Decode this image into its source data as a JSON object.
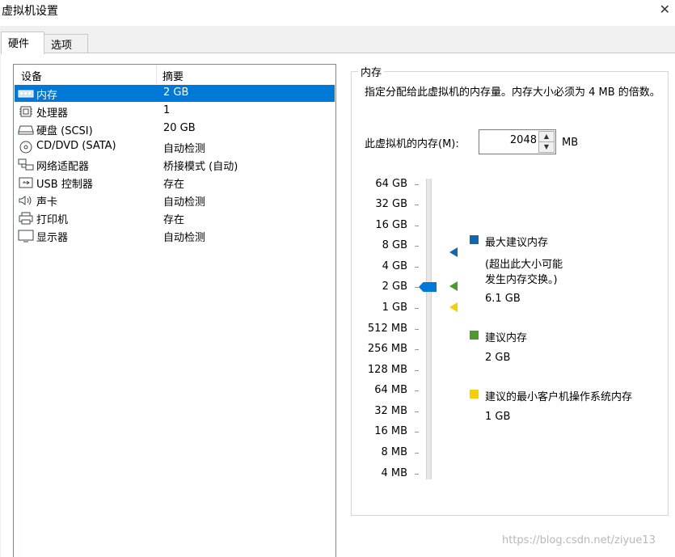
{
  "window": {
    "title": "虚拟机设置",
    "close_glyph": "✕"
  },
  "tabs": [
    {
      "label": "硬件",
      "active": true
    },
    {
      "label": "选项",
      "active": false
    }
  ],
  "device_list": {
    "headers": {
      "device": "设备",
      "summary": "摘要"
    },
    "rows": [
      {
        "icon": "memory-icon",
        "name": "内存",
        "summary": "2 GB",
        "selected": true
      },
      {
        "icon": "processor-icon",
        "name": "处理器",
        "summary": "1"
      },
      {
        "icon": "hard-disk-icon",
        "name": "硬盘 (SCSI)",
        "summary": "20 GB"
      },
      {
        "icon": "cd-dvd-icon",
        "name": "CD/DVD (SATA)",
        "summary": "自动检测"
      },
      {
        "icon": "network-adapter-icon",
        "name": "网络适配器",
        "summary": "桥接模式 (自动)"
      },
      {
        "icon": "usb-icon",
        "name": "USB 控制器",
        "summary": "存在"
      },
      {
        "icon": "sound-card-icon",
        "name": "声卡",
        "summary": "自动检测"
      },
      {
        "icon": "printer-icon",
        "name": "打印机",
        "summary": "存在"
      },
      {
        "icon": "display-icon",
        "name": "显示器",
        "summary": "自动检测"
      }
    ]
  },
  "memory_panel": {
    "group_title": "内存",
    "description": "指定分配给此虚拟机的内存量。内存大小必须为 4 MB 的倍数。",
    "field_label": "此虚拟机的内存(M):",
    "field_value": "2048",
    "unit": "MB",
    "scale_labels": [
      "64 GB",
      "32 GB",
      "16 GB",
      "8 GB",
      "4 GB",
      "2 GB",
      "1 GB",
      "512 MB",
      "256 MB",
      "128 MB",
      "64 MB",
      "32 MB",
      "16 MB",
      "8 MB",
      "4 MB"
    ],
    "legend": {
      "max": {
        "title": "最大建议内存",
        "note_line1": "(超出此大小可能",
        "note_line2": "发生内存交换。)",
        "value": "6.1 GB",
        "color": "#1066b0"
      },
      "recommended": {
        "title": "建议内存",
        "value": "2 GB",
        "color": "#4c9a2a"
      },
      "minimum": {
        "title": "建议的最小客户机操作系统内存",
        "value": "1 GB",
        "color": "#f4d000"
      }
    },
    "thumb_color": "#0078d7"
  },
  "watermark": "https://blog.csdn.net/ziyue13"
}
